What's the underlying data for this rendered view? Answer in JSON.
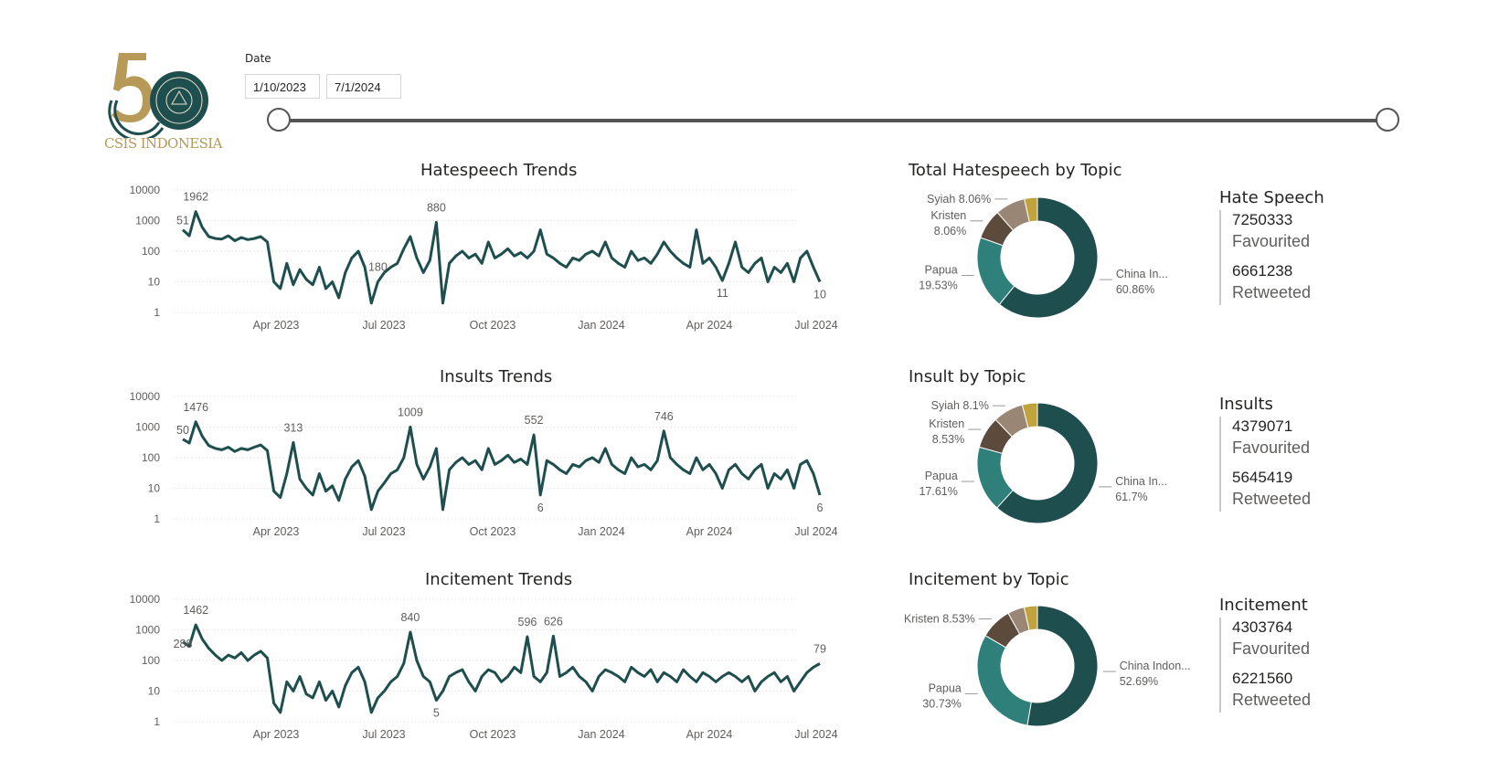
{
  "logo": {
    "text": "CSIS INDONESIA"
  },
  "date_slicer": {
    "label": "Date",
    "start": "1/10/2023",
    "end": "7/1/2024"
  },
  "colors": {
    "accent": "#1f4e4e",
    "teal": "#2f7f7a",
    "brown": "#5c4a3c",
    "taupe": "#9a8674",
    "gold": "#c1a33d"
  },
  "trends": [
    {
      "title": "Hatespeech Trends",
      "chart_data": {
        "type": "line",
        "y_scale": "log",
        "ylim": [
          1,
          10000
        ],
        "y_ticks": [
          "10000",
          "1000",
          "100",
          "10",
          "1"
        ],
        "x_ticks": [
          "Apr 2023",
          "Jul 2023",
          "Oct 2023",
          "Jan 2024",
          "Apr 2024",
          "Jul 2024"
        ],
        "series": [
          {
            "values": [
              500,
              320,
              1962,
              600,
              300,
              260,
              250,
              320,
              220,
              280,
              240,
              260,
              300,
              200,
              10,
              6,
              40,
              8,
              25,
              12,
              8,
              30,
              6,
              10,
              3,
              20,
              60,
              100,
              30,
              2,
              10,
              20,
              30,
              40,
              120,
              300,
              60,
              20,
              50,
              880,
              2,
              40,
              70,
              100,
              60,
              80,
              40,
              200,
              60,
              80,
              120,
              70,
              90,
              60,
              100,
              500,
              80,
              60,
              40,
              30,
              60,
              50,
              80,
              100,
              70,
              200,
              60,
              40,
              30,
              100,
              50,
              60,
              40,
              80,
              200,
              100,
              60,
              40,
              30,
              500,
              40,
              60,
              30,
              11,
              40,
              200,
              30,
              20,
              40,
              60,
              10,
              30,
              20,
              40,
              10,
              60,
              100,
              30,
              10
            ]
          }
        ],
        "labels": [
          "1962",
          "51",
          "180",
          "880",
          "11",
          "10"
        ]
      }
    },
    {
      "title": "Insults Trends",
      "chart_data": {
        "type": "line",
        "y_scale": "log",
        "ylim": [
          1,
          10000
        ],
        "y_ticks": [
          "10000",
          "1000",
          "100",
          "10",
          "1"
        ],
        "x_ticks": [
          "Apr 2023",
          "Jul 2023",
          "Oct 2023",
          "Jan 2024",
          "Apr 2024",
          "Jul 2024"
        ],
        "series": [
          {
            "values": [
              400,
              300,
              1476,
              500,
              250,
              200,
              180,
              220,
              160,
              200,
              180,
              220,
              260,
              170,
              8,
              5,
              30,
              313,
              20,
              10,
              6,
              30,
              8,
              12,
              4,
              20,
              50,
              80,
              25,
              2,
              8,
              15,
              30,
              40,
              100,
              1009,
              60,
              20,
              50,
              200,
              2,
              40,
              70,
              100,
              60,
              80,
              40,
              200,
              60,
              80,
              120,
              70,
              90,
              60,
              552,
              6,
              80,
              60,
              40,
              30,
              60,
              50,
              80,
              100,
              70,
              200,
              60,
              40,
              30,
              100,
              50,
              60,
              40,
              80,
              746,
              100,
              60,
              40,
              30,
              100,
              40,
              60,
              30,
              10,
              40,
              60,
              30,
              20,
              40,
              60,
              10,
              30,
              20,
              40,
              10,
              60,
              80,
              30,
              6
            ]
          }
        ],
        "labels": [
          "1476",
          "50",
          "313",
          "1009",
          "552",
          "6",
          "746",
          "6"
        ]
      }
    },
    {
      "title": "Incitement Trends",
      "chart_data": {
        "type": "line",
        "y_scale": "log",
        "ylim": [
          1,
          10000
        ],
        "y_ticks": [
          "10000",
          "1000",
          "100",
          "10",
          "1"
        ],
        "x_ticks": [
          "Apr 2023",
          "Jul 2023",
          "Oct 2023",
          "Jan 2024",
          "Apr 2024",
          "Jul 2024"
        ],
        "series": [
          {
            "values": [
              400,
              288,
              1462,
              500,
              250,
              150,
              100,
              150,
              120,
              180,
              100,
              150,
              200,
              120,
              4,
              2,
              20,
              10,
              30,
              8,
              6,
              20,
              5,
              10,
              3,
              15,
              40,
              60,
              20,
              2,
              6,
              10,
              20,
              30,
              80,
              840,
              100,
              30,
              20,
              5,
              10,
              30,
              40,
              50,
              20,
              10,
              30,
              50,
              40,
              20,
              30,
              60,
              40,
              596,
              30,
              20,
              40,
              626,
              30,
              40,
              60,
              30,
              20,
              10,
              30,
              50,
              40,
              30,
              20,
              60,
              40,
              30,
              50,
              20,
              40,
              30,
              20,
              50,
              30,
              20,
              40,
              30,
              20,
              30,
              40,
              30,
              20,
              30,
              10,
              20,
              30,
              40,
              20,
              30,
              10,
              20,
              40,
              60,
              79
            ]
          }
        ],
        "labels": [
          "1462",
          "288",
          "840",
          "5",
          "596",
          "626",
          "79"
        ]
      }
    }
  ],
  "donuts": [
    {
      "title": "Total Hatespeech by Topic",
      "chart_data": {
        "type": "pie",
        "slices": [
          {
            "label": "China In...",
            "value": 60.86,
            "display": "60.86%"
          },
          {
            "label": "Papua",
            "value": 19.53,
            "display": "19.53%"
          },
          {
            "label": "Kristen",
            "value": 8.06,
            "display": "8.06%"
          },
          {
            "label": "Syiah",
            "value": 8.06,
            "display": "8.06%"
          },
          {
            "label": "",
            "value": 3.49,
            "display": ""
          }
        ]
      }
    },
    {
      "title": "Insult by Topic",
      "chart_data": {
        "type": "pie",
        "slices": [
          {
            "label": "China In...",
            "value": 61.7,
            "display": "61.7%"
          },
          {
            "label": "Papua",
            "value": 17.61,
            "display": "17.61%"
          },
          {
            "label": "Kristen",
            "value": 8.53,
            "display": "8.53%"
          },
          {
            "label": "Syiah",
            "value": 8.1,
            "display": "8.1%"
          },
          {
            "label": "",
            "value": 4.06,
            "display": ""
          }
        ]
      }
    },
    {
      "title": "Incitement by Topic",
      "chart_data": {
        "type": "pie",
        "slices": [
          {
            "label": "China Indon...",
            "value": 52.69,
            "display": "52.69%"
          },
          {
            "label": "Papua",
            "value": 30.73,
            "display": "30.73%"
          },
          {
            "label": "Kristen",
            "value": 8.53,
            "display": "8.53%"
          },
          {
            "label": "",
            "value": 4.5,
            "display": ""
          },
          {
            "label": "",
            "value": 3.55,
            "display": ""
          }
        ]
      }
    }
  ],
  "kpis": [
    {
      "title": "Hate Speech",
      "favourited": "7250333",
      "favourited_label": "Favourited",
      "retweeted": "6661238",
      "retweeted_label": "Retweeted"
    },
    {
      "title": "Insults",
      "favourited": "4379071",
      "favourited_label": "Favourited",
      "retweeted": "5645419",
      "retweeted_label": "Retweeted"
    },
    {
      "title": "Incitement",
      "favourited": "4303764",
      "favourited_label": "Favourited",
      "retweeted": "6221560",
      "retweeted_label": "Retweeted"
    }
  ]
}
